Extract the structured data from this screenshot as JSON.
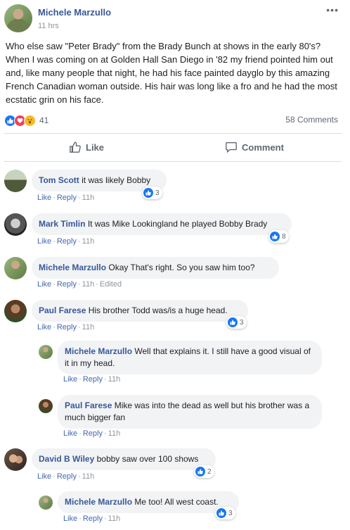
{
  "post": {
    "author": "Michele Marzullo",
    "time": "11 hrs",
    "body": "Who else saw \"Peter Brady\" from the Brady Bunch at shows in the early 80's? When I was coming on at Golden Hall San Diego in '82 my friend pointed him out and, like many people that night, he had his face painted dayglo by this amazing French Canadian woman outside. His hair was long like a fro and he had the most ecstatic grin on his face.",
    "reaction_count": "41",
    "comments_count": "58 Comments",
    "more_icon": "more-dots-icon",
    "colors": {
      "link": "#385898",
      "like_blue": "#1877f2",
      "love_red": "#f33e58",
      "wow_yellow": "#f7b928"
    }
  },
  "actions": {
    "like_label": "Like",
    "comment_label": "Comment"
  },
  "comment_actions": {
    "like": "Like",
    "reply": "Reply",
    "edited": "Edited"
  },
  "comments": [
    {
      "author": "Tom Scott",
      "text": "it was likely Bobby",
      "time": "11h",
      "likes": "3"
    },
    {
      "author": "Mark Timlin",
      "text": "It was Mike Lookingland he played Bobby Brady",
      "time": "11h",
      "likes": "8"
    },
    {
      "author": "Michele Marzullo",
      "text": "Okay That's right. So you saw him too?",
      "time": "11h",
      "edited": true
    },
    {
      "author": "Paul Farese",
      "text": "His brother Todd was/is a huge head.",
      "time": "11h",
      "likes": "3"
    },
    {
      "author": "Michele Marzullo",
      "text": "Well that explains it. I still have a good visual of it in my head.",
      "time": "11h",
      "reply": true
    },
    {
      "author": "Paul Farese",
      "text": "Mike was into the dead as well but his brother was a much bigger fan",
      "time": "11h",
      "reply": true
    },
    {
      "author": "David B Wiley",
      "text": "bobby saw over 100 shows",
      "time": "11h",
      "likes": "2"
    },
    {
      "author": "Michele Marzullo",
      "text": "Me too! All west coast.",
      "time": "11h",
      "likes": "3",
      "reply": true
    }
  ]
}
